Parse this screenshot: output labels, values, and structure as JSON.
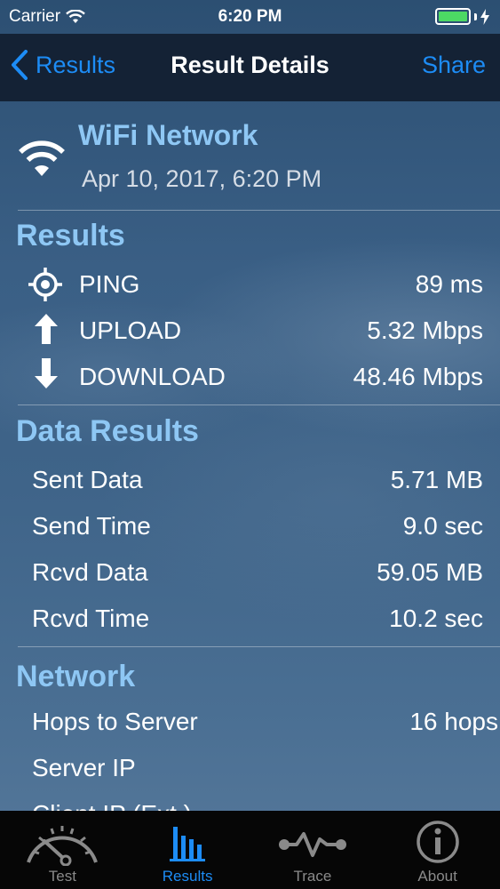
{
  "status_bar": {
    "carrier": "Carrier",
    "time": "6:20 PM"
  },
  "nav": {
    "back_label": "Results",
    "title": "Result Details",
    "share_label": "Share"
  },
  "network": {
    "name": "WiFi Network",
    "date": "Apr 10, 2017, 6:20 PM"
  },
  "results": {
    "title": "Results",
    "rows": [
      {
        "icon": "crosshair-icon",
        "label": "PING",
        "value": "89 ms"
      },
      {
        "icon": "upload-arrow-icon",
        "label": "UPLOAD",
        "value": "5.32 Mbps"
      },
      {
        "icon": "download-arrow-icon",
        "label": "DOWNLOAD",
        "value": "48.46 Mbps"
      }
    ]
  },
  "data_results": {
    "title": "Data Results",
    "rows": [
      {
        "label": "Sent Data",
        "value": "5.71 MB"
      },
      {
        "label": "Send Time",
        "value": "9.0 sec"
      },
      {
        "label": "Rcvd Data",
        "value": "59.05 MB"
      },
      {
        "label": "Rcvd Time",
        "value": "10.2 sec"
      }
    ]
  },
  "network_section": {
    "title": "Network",
    "rows": [
      {
        "label": "Hops to Server",
        "value": "16 hops"
      },
      {
        "label": "Server IP",
        "value": ""
      },
      {
        "label": "Client IP (Ext.)",
        "value": ""
      }
    ]
  },
  "tabs": [
    {
      "label": "Test",
      "icon": "speedometer-icon",
      "active": false
    },
    {
      "label": "Results",
      "icon": "bar-chart-icon",
      "active": true
    },
    {
      "label": "Trace",
      "icon": "trace-icon",
      "active": false
    },
    {
      "label": "About",
      "icon": "info-icon",
      "active": false
    }
  ],
  "colors": {
    "accent": "#1d8cf5",
    "section_title": "#8ec7f4",
    "battery": "#4cd964",
    "nav_background": "#142235",
    "tab_background": "#060606"
  }
}
